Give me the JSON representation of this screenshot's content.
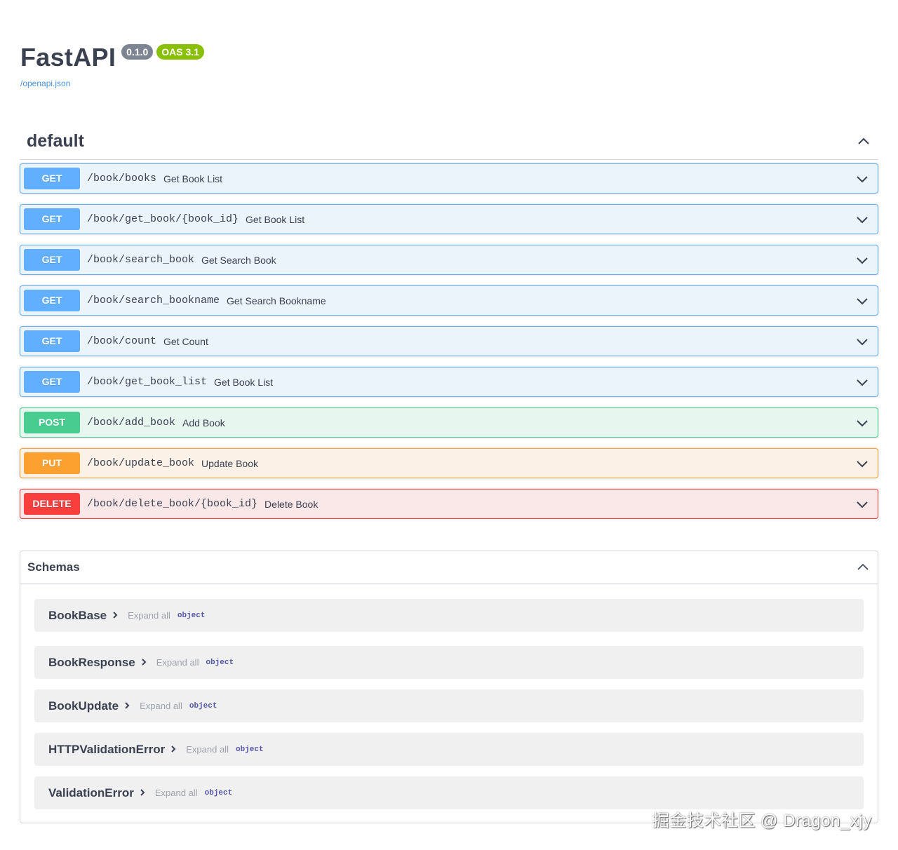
{
  "info": {
    "title": "FastAPI",
    "version": "0.1.0",
    "oas": "OAS 3.1",
    "spec_link": "/openapi.json"
  },
  "tag": {
    "name": "default"
  },
  "operations": [
    {
      "method": "GET",
      "path": "/book/books",
      "summary": "Get Book List"
    },
    {
      "method": "GET",
      "path": "/book/get_book/{book_id}",
      "summary": "Get Book List"
    },
    {
      "method": "GET",
      "path": "/book/search_book",
      "summary": "Get Search Book"
    },
    {
      "method": "GET",
      "path": "/book/search_bookname",
      "summary": "Get Search Bookname"
    },
    {
      "method": "GET",
      "path": "/book/count",
      "summary": "Get Count"
    },
    {
      "method": "GET",
      "path": "/book/get_book_list",
      "summary": "Get Book List"
    },
    {
      "method": "POST",
      "path": "/book/add_book",
      "summary": "Add Book"
    },
    {
      "method": "PUT",
      "path": "/book/update_book",
      "summary": "Update Book"
    },
    {
      "method": "DELETE",
      "path": "/book/delete_book/{book_id}",
      "summary": "Delete Book"
    }
  ],
  "schemas": {
    "title": "Schemas",
    "models": [
      {
        "name": "BookBase",
        "expand": "Expand all",
        "type": "object"
      },
      {
        "name": "BookResponse",
        "expand": "Expand all",
        "type": "object"
      },
      {
        "name": "BookUpdate",
        "expand": "Expand all",
        "type": "object"
      },
      {
        "name": "HTTPValidationError",
        "expand": "Expand all",
        "type": "object"
      },
      {
        "name": "ValidationError",
        "expand": "Expand all",
        "type": "object"
      }
    ]
  },
  "colors": {
    "get": "#61affe",
    "post": "#49cc90",
    "put": "#fca130",
    "delete": "#f93e3e",
    "oas_badge": "#89bf04",
    "version_badge": "#7d8492"
  },
  "icons": {
    "collapse": "chevron-up-icon",
    "expand": "chevron-down-icon",
    "model_expand": "chevron-right-icon"
  },
  "watermark": "掘金技术社区 @ Dragon_xjy"
}
